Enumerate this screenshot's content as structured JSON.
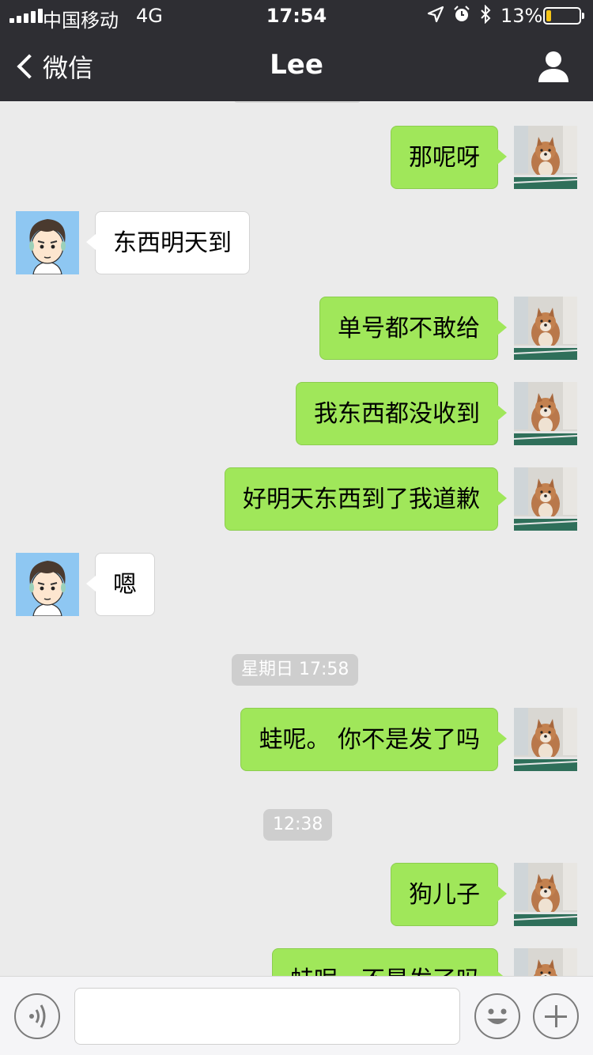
{
  "status_bar": {
    "carrier": "中国移动",
    "network": "4G",
    "time": "17:54",
    "battery_percent": "13%",
    "battery_level": 0.13,
    "icons": [
      "location-arrow-icon",
      "alarm-clock-icon",
      "bluetooth-icon"
    ]
  },
  "nav": {
    "back_label": "微信",
    "title": "Lee",
    "profile_icon": "person-icon"
  },
  "colors": {
    "nav_bg": "#2e2e33",
    "chat_bg": "#ebebeb",
    "outgoing_bubble": "#a0e75a",
    "incoming_bubble": "#ffffff",
    "timestamp_chip": "#cecece",
    "battery_fill": "#f5c518"
  },
  "messages": [
    {
      "direction": "out",
      "text": "那呢呀"
    },
    {
      "direction": "in",
      "text": "东西明天到"
    },
    {
      "direction": "out",
      "text": "单号都不敢给"
    },
    {
      "direction": "out",
      "text": "我东西都没收到"
    },
    {
      "direction": "out",
      "text": "好明天东西到了我道歉"
    },
    {
      "direction": "in",
      "text": "嗯"
    },
    {
      "timestamp": "星期日 17:58"
    },
    {
      "direction": "out",
      "text": "蛙呢。 你不是发了吗"
    },
    {
      "timestamp": "12:38"
    },
    {
      "direction": "out",
      "text": "狗儿子"
    },
    {
      "direction": "out",
      "text": "蛙呢。不是发了吗"
    }
  ],
  "input_bar": {
    "voice_icon": "voice-icon",
    "emoji_icon": "emoji-icon",
    "plus_icon": "plus-icon",
    "placeholder": ""
  }
}
